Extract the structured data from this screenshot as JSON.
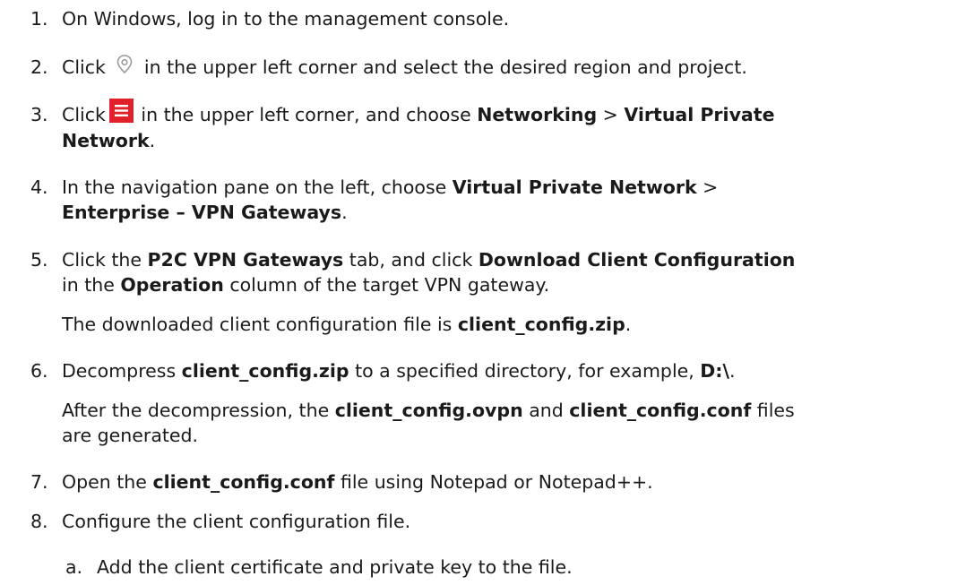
{
  "steps": [
    {
      "num": "1.",
      "segments": [
        {
          "t": "On Windows, log in to the management console."
        }
      ]
    },
    {
      "num": "2.",
      "pre": "Click ",
      "icon": "location-pin-icon",
      "post": " in the upper left corner and select the desired region and project."
    },
    {
      "num": "3.",
      "pre": "Click",
      "icon": "menu-icon",
      "segments": [
        {
          "t": " in the upper left corner, and choose "
        },
        {
          "t": "Networking",
          "b": true
        },
        {
          "t": " > "
        },
        {
          "t": "Virtual Private",
          "b": true
        }
      ],
      "line2": "Network",
      "line2_tail": "."
    },
    {
      "num": "4.",
      "segments": [
        {
          "t": "In the navigation pane on the left, choose "
        },
        {
          "t": "Virtual Private Network",
          "b": true
        },
        {
          "t": " >"
        }
      ],
      "line2": "Enterprise – VPN Gateways",
      "line2_tail": "."
    },
    {
      "num": "5.",
      "segments": [
        {
          "t": "Click the "
        },
        {
          "t": "P2C VPN Gateways",
          "b": true
        },
        {
          "t": " tab, and click "
        },
        {
          "t": "Download Client Configuration",
          "b": true
        }
      ],
      "line2_segments": [
        {
          "t": "in the "
        },
        {
          "t": "Operation",
          "b": true
        },
        {
          "t": " column of the target VPN gateway."
        }
      ],
      "note": [
        {
          "t": "The downloaded client configuration file is "
        },
        {
          "t": "client_config.zip",
          "b": true
        },
        {
          "t": "."
        }
      ]
    },
    {
      "num": "6.",
      "segments": [
        {
          "t": "Decompress "
        },
        {
          "t": "client_config.zip",
          "b": true
        },
        {
          "t": " to a specified directory, for example, "
        },
        {
          "t": "D:\\",
          "b": true
        },
        {
          "t": "."
        }
      ],
      "note": [
        {
          "t": "After the decompression, the "
        },
        {
          "t": "client_config.ovpn",
          "b": true
        },
        {
          "t": " and "
        },
        {
          "t": "client_config.conf",
          "b": true
        },
        {
          "t": " files"
        }
      ],
      "note_line2": "are generated."
    },
    {
      "num": "7.",
      "segments": [
        {
          "t": "Open the "
        },
        {
          "t": "client_config.conf",
          "b": true
        },
        {
          "t": " file using Notepad or Notepad++."
        }
      ]
    },
    {
      "num": "8.",
      "segments": [
        {
          "t": "Configure the client configuration file."
        }
      ]
    }
  ],
  "substeps": [
    {
      "num": "a.",
      "text": "Add the client certificate and private key to the file."
    }
  ]
}
